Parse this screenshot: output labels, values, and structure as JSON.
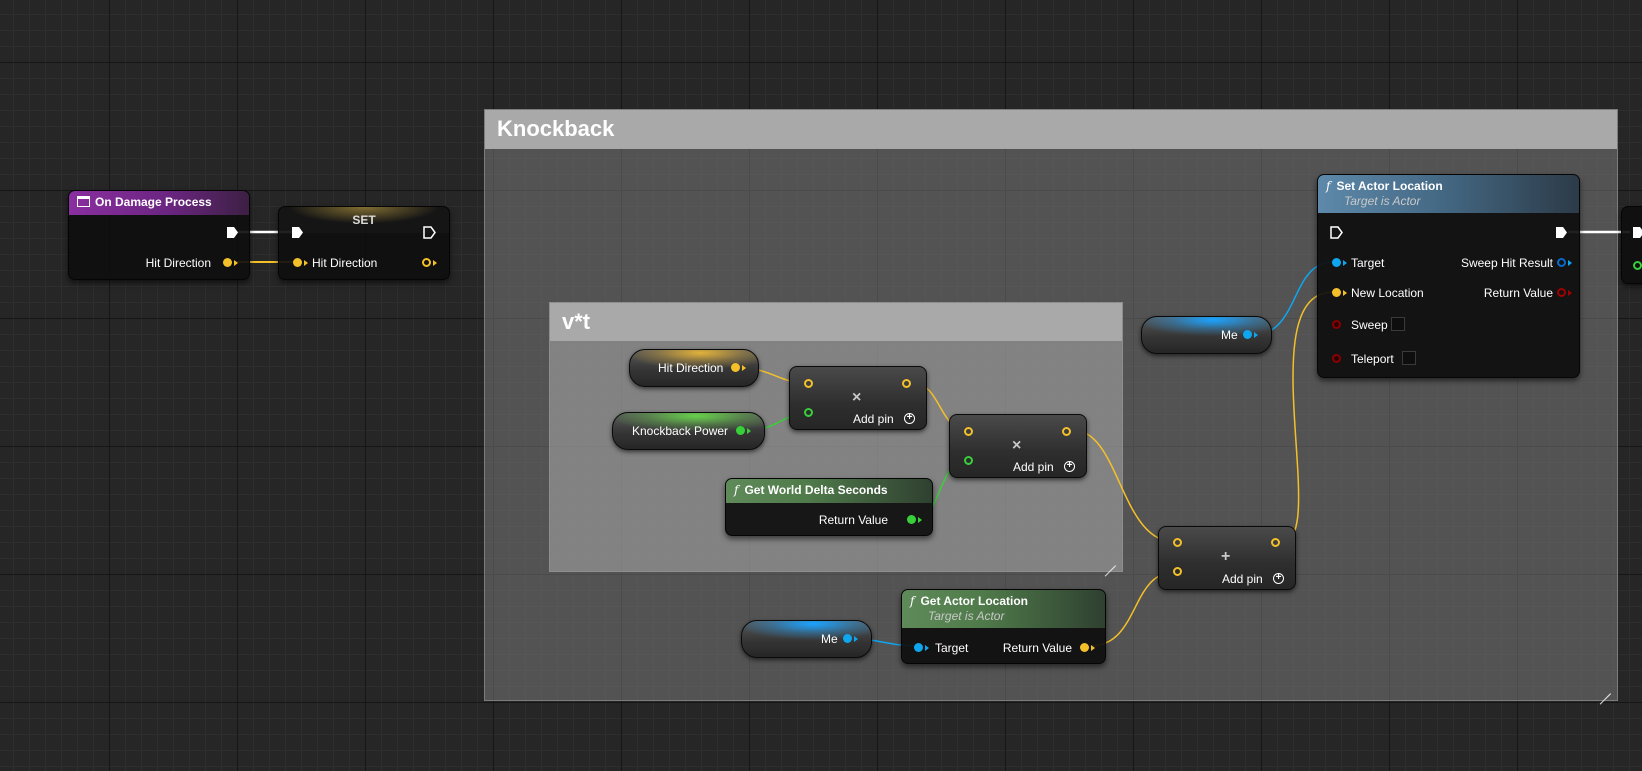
{
  "comments": {
    "knockback": {
      "title": "Knockback"
    },
    "vt": {
      "title": "v*t"
    }
  },
  "event_node": {
    "title": "On Damage Process",
    "pin_hit_direction": "Hit Direction",
    "header_color": "#7a2a8c"
  },
  "set_node": {
    "title": "SET",
    "pin_hit_direction": "Hit Direction"
  },
  "var_hit_direction": {
    "label": "Hit Direction"
  },
  "var_knockback_power": {
    "label": "Knockback Power"
  },
  "multiply_node_1": {
    "symbol": "×",
    "add_pin": "Add pin"
  },
  "multiply_node_2": {
    "symbol": "×",
    "add_pin": "Add pin"
  },
  "add_node": {
    "symbol": "+",
    "add_pin": "Add pin"
  },
  "get_world_delta_seconds": {
    "title": "Get World Delta Seconds",
    "return_value": "Return Value"
  },
  "get_actor_location": {
    "title": "Get Actor Location",
    "subtitle": "Target is Actor",
    "target": "Target",
    "return_value": "Return Value"
  },
  "self_ref_1": {
    "label": "Me"
  },
  "self_ref_2": {
    "label": "Me"
  },
  "set_actor_location": {
    "title": "Set Actor Location",
    "subtitle": "Target is Actor",
    "target": "Target",
    "new_location": "New Location",
    "sweep": "Sweep",
    "teleport": "Teleport",
    "sweep_hit_result": "Sweep Hit Result",
    "return_value": "Return Value"
  },
  "colors": {
    "vector_pin": "#f4c02a",
    "float_pin": "#38d03a",
    "object_pin": "#0fa6f0",
    "struct_pin": "#0a6acc",
    "bool_pin": "#8c0a0a",
    "exec_pin": "#ffffff",
    "function_header_blue": "#4a6f8a",
    "pure_header_green": "#4f7a4a",
    "event_header": "#7a2a8c",
    "comment_title": "#a9a9a9"
  }
}
